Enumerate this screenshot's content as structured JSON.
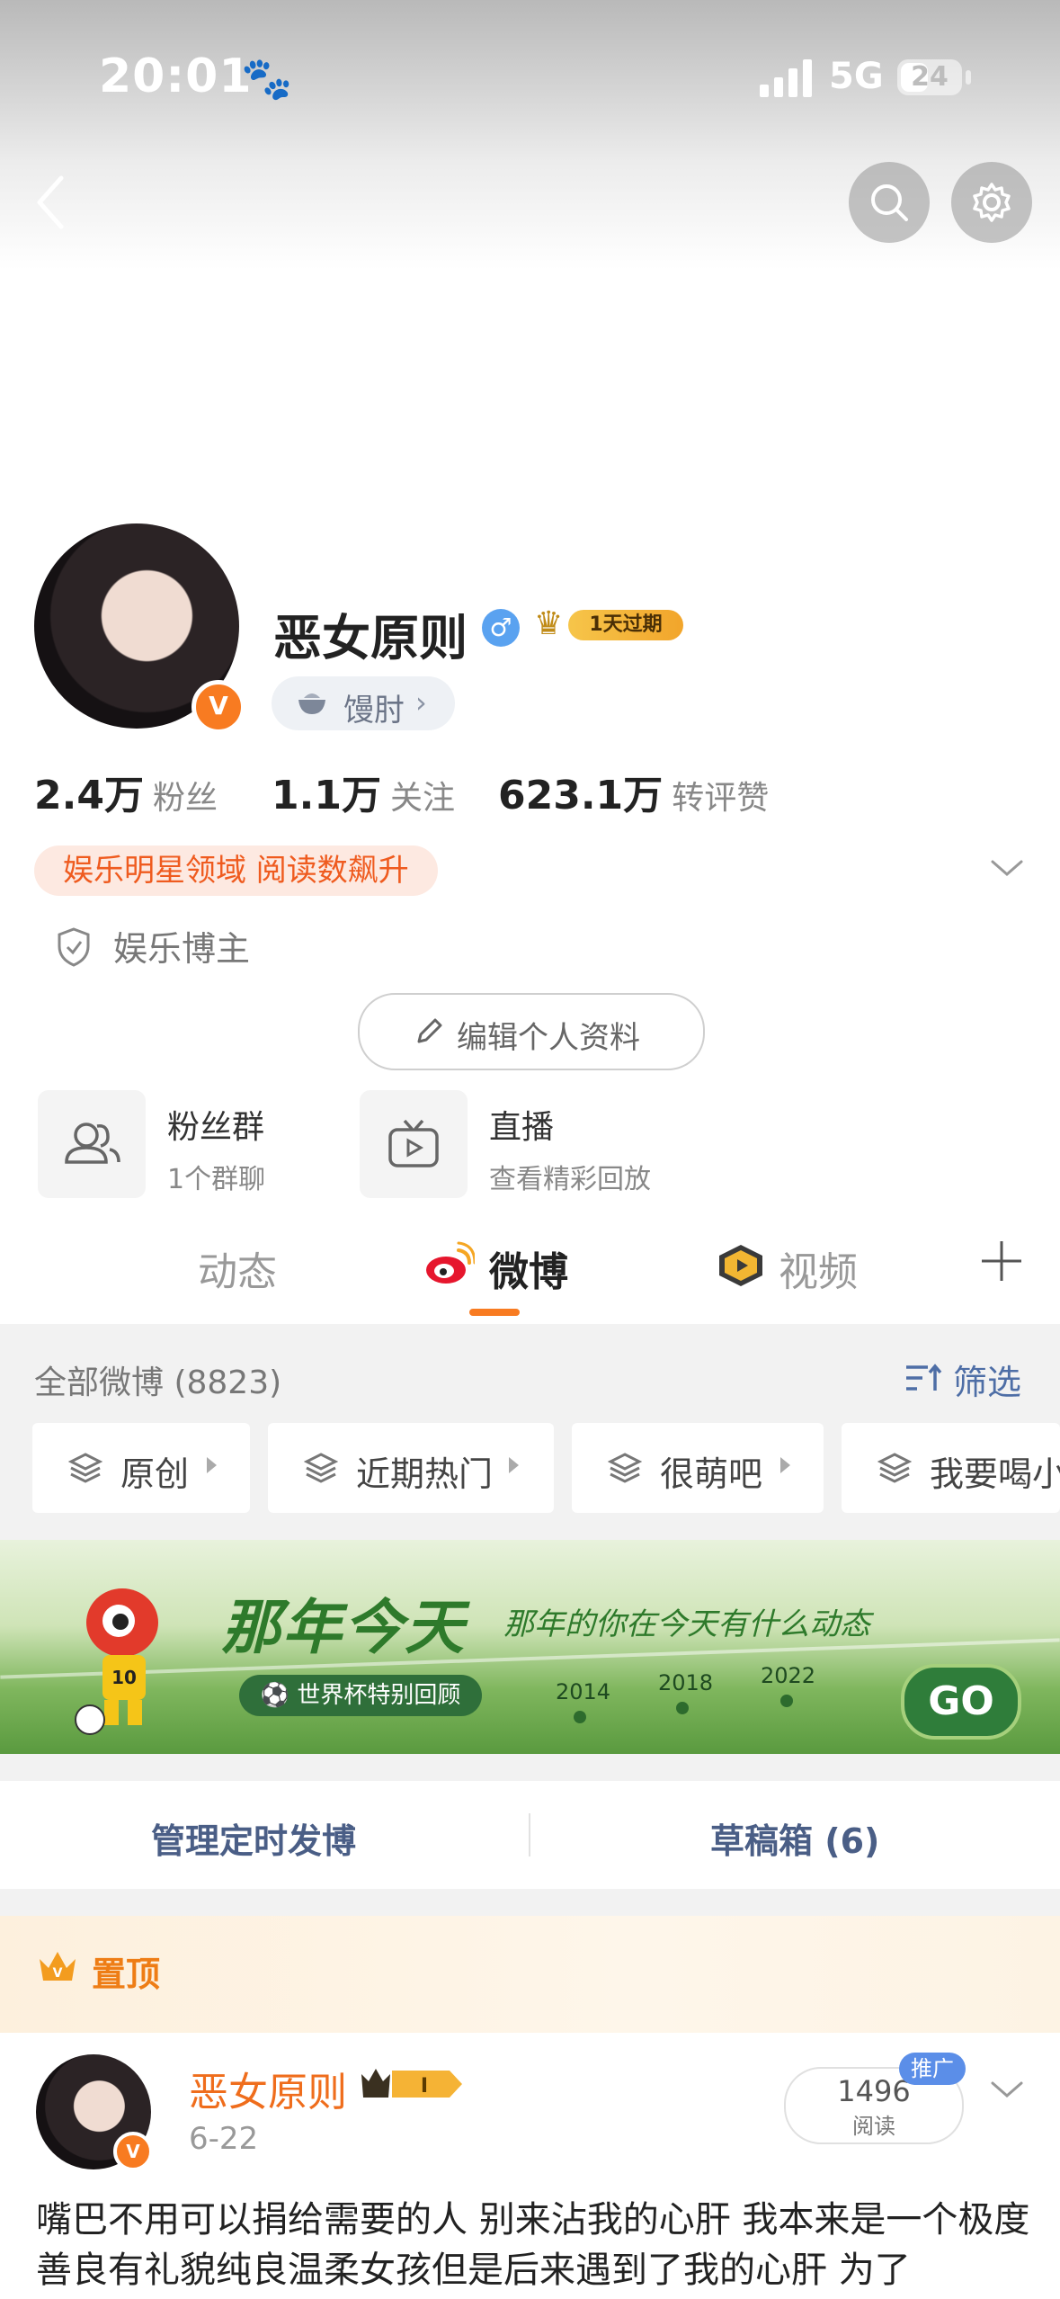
{
  "status_bar": {
    "time": "20:01",
    "network": "5G",
    "battery": "24"
  },
  "profile": {
    "name": "恶女原则",
    "vip_badge": "1天过期",
    "tag": "馒肘",
    "stats": [
      {
        "value": "2.4万",
        "label": "粉丝"
      },
      {
        "value": "1.1万",
        "label": "关注"
      },
      {
        "value": "623.1万",
        "label": "转评赞"
      }
    ],
    "hot_tag": "娱乐明星领域 阅读数飙升",
    "blogger_type": "娱乐博主",
    "edit_button": "编辑个人资料",
    "features": [
      {
        "title": "粉丝群",
        "subtitle": "1个群聊"
      },
      {
        "title": "直播",
        "subtitle": "查看精彩回放"
      }
    ]
  },
  "tabs": [
    "动态",
    "微博",
    "视频"
  ],
  "feed": {
    "all_label": "全部微博 (8823)",
    "filter_label": "筛选",
    "filter_chips": [
      "原创",
      "近期热门",
      "很萌吧",
      "我要喝小"
    ]
  },
  "banner": {
    "title": "那年今天",
    "subtitle": "那年的你在今天有什么动态",
    "pill": "世界杯特别回顾",
    "years": [
      "2014",
      "2018",
      "2022"
    ],
    "go": "GO"
  },
  "manage": {
    "scheduled": "管理定时发博",
    "drafts": "草稿箱 (6)"
  },
  "post": {
    "pinned_label": "置顶",
    "author": "恶女原则",
    "date": "6-22",
    "reads": "1496",
    "reads_label": "阅读",
    "promo": "推广",
    "text": "嘴巴不用可以捐给需要的人 别来沾我的心肝 我本来是一个极度善良有礼貌纯良温柔女孩但是后来遇到了我的心肝 为了"
  }
}
